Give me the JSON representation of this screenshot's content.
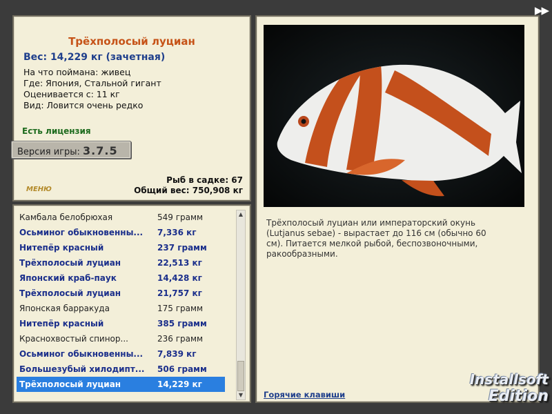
{
  "header": {
    "next_icon": "double-arrow-right"
  },
  "fish": {
    "title": "Трёхполосый луциан",
    "weight": "Вес: 14,229 кг (зачетная)",
    "caught_on": "На что поймана: живец",
    "where": "Где: Япония, Стальной гигант",
    "valued_from": "Оценивается с: 11 кг",
    "kind": "Вид: Ловится очень редко",
    "license": "Есть лицензия"
  },
  "version": {
    "label": "Версия игры:",
    "number": "3.7.5"
  },
  "menu_logo": "МЕНЮ",
  "stats": {
    "in_keepnet": "Рыб в садке: 67",
    "total_weight": "Общий вес: 750,908 кг"
  },
  "catch_list": [
    {
      "name": "Камбала белобрюхая",
      "weight": "549 грамм",
      "style": "normal"
    },
    {
      "name": "Осьминог обыкновенны...",
      "weight": "7,336 кг",
      "style": "bold"
    },
    {
      "name": "Нитепёр красный",
      "weight": "237 грамм",
      "style": "bold"
    },
    {
      "name": "Трёхполосый луциан",
      "weight": "22,513 кг",
      "style": "bold"
    },
    {
      "name": "Японский краб-паук",
      "weight": "14,428 кг",
      "style": "bold"
    },
    {
      "name": "Трёхполосый луциан",
      "weight": "21,757 кг",
      "style": "bold"
    },
    {
      "name": "Японская барракуда",
      "weight": "175 грамм",
      "style": "normal"
    },
    {
      "name": "Нитепёр красный",
      "weight": "385 грамм",
      "style": "bold"
    },
    {
      "name": "Краснохвостый спинор...",
      "weight": "236 грамм",
      "style": "normal"
    },
    {
      "name": "Осьминог обыкновенны...",
      "weight": "7,839 кг",
      "style": "bold"
    },
    {
      "name": "Большезубый хилодипт...",
      "weight": "506 грамм",
      "style": "bold"
    },
    {
      "name": "Трёхполосый луциан",
      "weight": "14,229 кг",
      "style": "selected"
    }
  ],
  "detail": {
    "description": "Трёхполосый луциан или императорский окунь (Lutjanus sebae) - вырастает до 116 см (обычно 60 см). Питается мелкой рыбой, беспозвоночными, ракообразными.",
    "hotkeys": "Горячие клавиши"
  },
  "watermark": {
    "line1": "Installsoft",
    "line2": "Edition"
  },
  "colors": {
    "title": "#c65318",
    "accent_blue": "#1f3f8c",
    "license_green": "#1d6b1d",
    "selected_row": "#2a7fe0"
  }
}
